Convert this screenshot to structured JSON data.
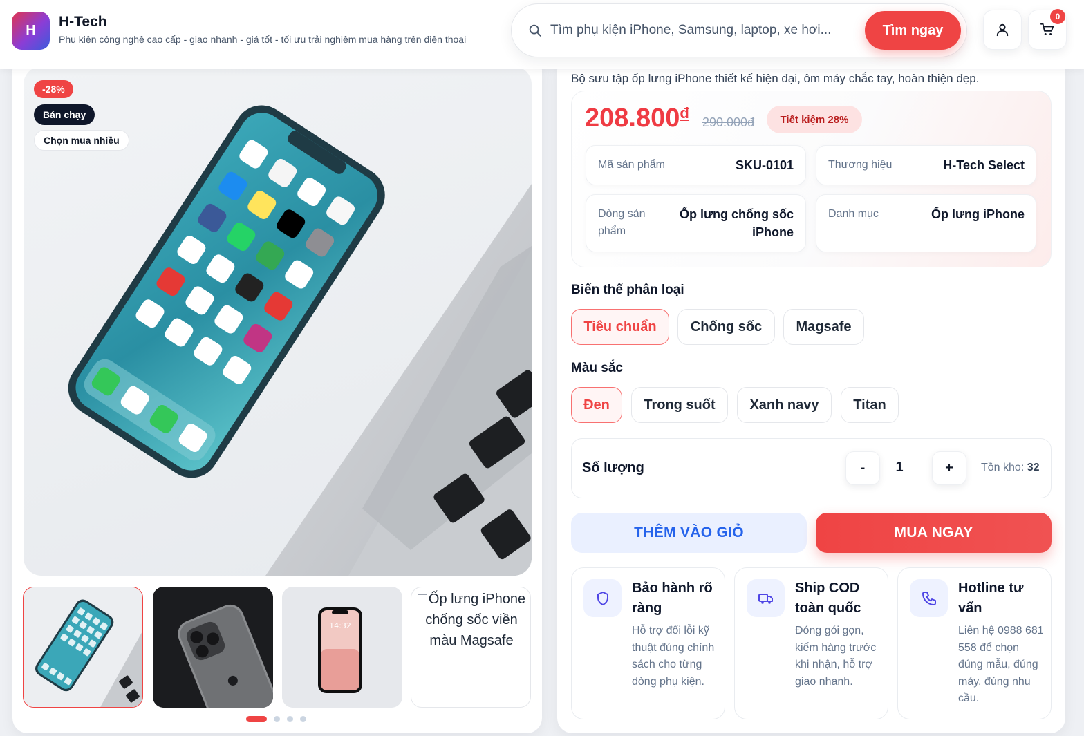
{
  "header": {
    "logo_letter": "H",
    "brand_name": "H-Tech",
    "tagline": "Phụ kiện công nghệ cao cấp - giao nhanh - giá tốt - tối ưu trải nghiệm mua hàng trên điện thoại",
    "search_placeholder": "Tìm phụ kiện iPhone, Samsung, laptop, xe hơi...",
    "search_button": "Tìm ngay",
    "cart_count": "0",
    "icons": [
      "search-icon",
      "user-icon",
      "cart-icon"
    ]
  },
  "gallery": {
    "badges": {
      "discount": "-28%",
      "best_seller": "Bán chạy",
      "popular": "Chọn mua nhiều"
    },
    "broken_thumb_alt": "Ốp lưng iPhone chống sốc viền màu Magsafe",
    "slide_count": 4,
    "active_slide": 1
  },
  "product": {
    "description": "Bộ sưu tập ốp lưng iPhone thiết kế hiện đại, ôm máy chắc tay, hoàn thiện đẹp.",
    "price": "208.800",
    "currency": "đ",
    "old_price": "290.000đ",
    "save_label": "Tiết kiệm 28%",
    "specs": {
      "sku": {
        "label": "Mã sản phẩm",
        "value": "SKU-0101"
      },
      "brand": {
        "label": "Thương hiệu",
        "value": "H-Tech Select"
      },
      "line": {
        "label": "Dòng sản phẩm",
        "value": "Ốp lưng chống sốc iPhone"
      },
      "category": {
        "label": "Danh mục",
        "value": "Ốp lưng iPhone"
      }
    },
    "variant_label": "Biến thể phân loại",
    "variants": [
      "Tiêu chuẩn",
      "Chống sốc",
      "Magsafe"
    ],
    "selected_variant": "Tiêu chuẩn",
    "color_label": "Màu sắc",
    "colors": [
      "Đen",
      "Trong suốt",
      "Xanh navy",
      "Titan"
    ],
    "selected_color": "Đen",
    "quantity_label": "Số lượng",
    "quantity": "1",
    "minus": "-",
    "plus": "+",
    "stock_label": "Tồn kho:",
    "stock_value": "32",
    "add_to_cart": "THÊM VÀO GIỎ",
    "buy_now": "MUA NGAY"
  },
  "features": [
    {
      "icon": "shield-icon",
      "title": "Bảo hành rõ ràng",
      "text": "Hỗ trợ đổi lỗi kỹ thuật đúng chính sách cho từng dòng phụ kiện."
    },
    {
      "icon": "truck-icon",
      "title": "Ship COD toàn quốc",
      "text": "Đóng gói gọn, kiểm hàng trước khi nhận, hỗ trợ giao nhanh."
    },
    {
      "icon": "phone-icon",
      "title": "Hotline tư vấn",
      "text": "Liên hệ 0988 681 558 để chọn đúng mẫu, đúng máy, đúng nhu cầu."
    }
  ],
  "colors": {
    "accent": "#ef4444",
    "primary_blue": "#2563eb",
    "dark": "#0f172a"
  }
}
